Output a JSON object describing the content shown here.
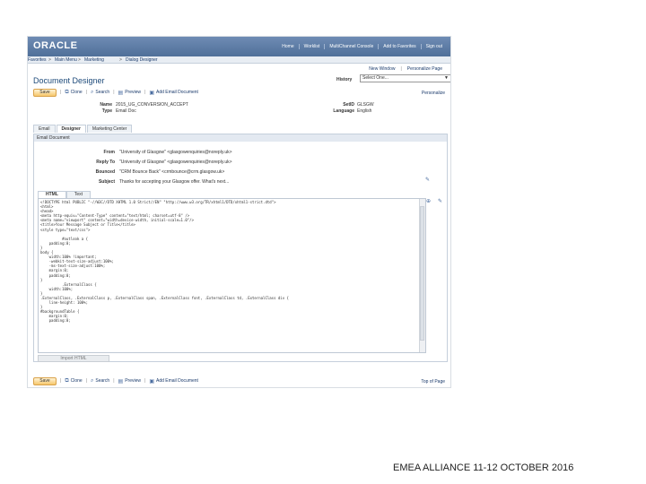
{
  "header": {
    "logo": "ORACLE",
    "links": [
      "Home",
      "Worklist",
      "MultiChannel Console",
      "Add to Favorites",
      "Sign out"
    ]
  },
  "nav": {
    "items": [
      "Favorites",
      "Main Menu",
      "Marketing",
      "Dialog Designer"
    ],
    "separators": [
      ">",
      ">",
      ">"
    ]
  },
  "subnav": {
    "new_window": "New Window",
    "sep": "|",
    "personalize_page": "Personalize Page"
  },
  "page": {
    "title": "Document Designer",
    "history_label": "History",
    "history_value": "Select One..."
  },
  "toolbar": {
    "save": "Save",
    "clone": "Clone",
    "search": "Search",
    "preview": "Preview",
    "add": "Add Email Document",
    "personalize": "Personalize",
    "sep": "|"
  },
  "fields": {
    "name_label": "Name",
    "name_value": "2015_UG_CONVERSION_ACCEPT",
    "type_label": "Type",
    "type_value": "Email Doc",
    "setid_label": "SetID",
    "setid_value": "GLSGW",
    "language_label": "Language",
    "language_value": "English"
  },
  "tabs": [
    "Email",
    "Designer",
    "Marketing Center"
  ],
  "panel": {
    "title": "Email Document"
  },
  "email": {
    "from_label": "From",
    "from_value": "\"University of Glasgow\" <glasgowenquiries@noreply.uk>",
    "reply_label": "Reply To",
    "reply_value": "\"University of Glasgow\" <glasgowenquiries@noreply.uk>",
    "bounce_label": "Bounced",
    "bounce_value": "\"CRM Bounce Back\" <crmbounce@crm.glasgow.uk>",
    "subject_label": "Subject",
    "subject_value": "Thanks for accepting your Glasgow offer. What's next..."
  },
  "code_tabs": [
    "HTML",
    "Text"
  ],
  "code": [
    "<!DOCTYPE html PUBLIC \"-//W3C//DTD XHTML 1.0 Strict//EN\" \"http://www.w3.org/TR/xhtml1/DTD/xhtml1-strict.dtd\">",
    "<html>",
    "<head>",
    "<meta http-equiv=\"Content-Type\" content=\"text/html; charset=utf-8\" />",
    "<meta name=\"viewport\" content=\"width=device-width, initial-scale=1.0\"/>",
    "<title>Your Message Subject or Title</title>",
    "<style type=\"text/css\">",
    "",
    "          #outlook a {",
    "    padding:0;",
    "}",
    "body {",
    "    width:100% !important;",
    "    -webkit-text-size-adjust:100%;",
    "    -ms-text-size-adjust:100%;",
    "    margin:0;",
    "    padding:0;",
    "}",
    "          .ExternalClass {",
    "    width:100%;",
    "}",
    ".ExternalClass, .ExternalClass p, .ExternalClass span, .ExternalClass font, .ExternalClass td, .ExternalClass div {",
    "    line-height: 100%;",
    "}",
    "#backgroundTable {",
    "    margin:0;",
    "    padding:0;"
  ],
  "import_html": "Import HTML",
  "top_of_page": "Top of Page",
  "footer": {
    "text": "EMEA ALLIANCE   11-12 OCTOBER 2016"
  }
}
